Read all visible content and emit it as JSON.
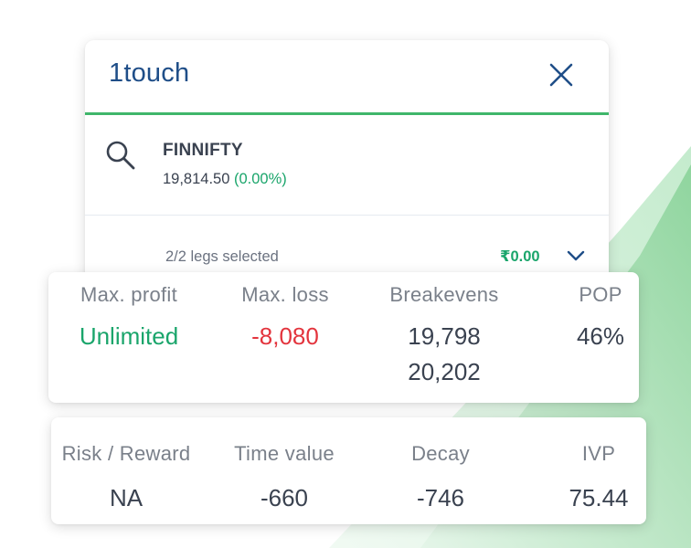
{
  "app": {
    "title": "1touch"
  },
  "instrument": {
    "symbol": "FINNIFTY",
    "price": "19,814.50",
    "change": "(0.00%)"
  },
  "legs": {
    "summary": "2/2 legs selected",
    "amount": "₹0.00"
  },
  "stats_primary": [
    {
      "label": "Max. profit",
      "values": [
        "Unlimited"
      ],
      "tone": "positive"
    },
    {
      "label": "Max. loss",
      "values": [
        "-8,080"
      ],
      "tone": "negative"
    },
    {
      "label": "Breakevens",
      "values": [
        "19,798",
        "20,202"
      ],
      "tone": "neutral"
    },
    {
      "label": "POP",
      "values": [
        "46%"
      ],
      "tone": "neutral"
    }
  ],
  "stats_secondary": [
    {
      "label": "Risk / Reward",
      "value": "NA"
    },
    {
      "label": "Time value",
      "value": "-660"
    },
    {
      "label": "Decay",
      "value": "-746"
    },
    {
      "label": "IVP",
      "value": "75.44"
    }
  ],
  "colors": {
    "brand_blue": "#1f4e88",
    "accent_green": "#3fb66a",
    "positive": "#1aa56b",
    "negative": "#e3343d",
    "text_dark": "#3a4250",
    "text_muted": "#7a808a",
    "background_shape": "#8fd59e"
  },
  "icons": {
    "close": "close-icon",
    "search": "search-icon",
    "expand": "chevron-down-icon"
  }
}
